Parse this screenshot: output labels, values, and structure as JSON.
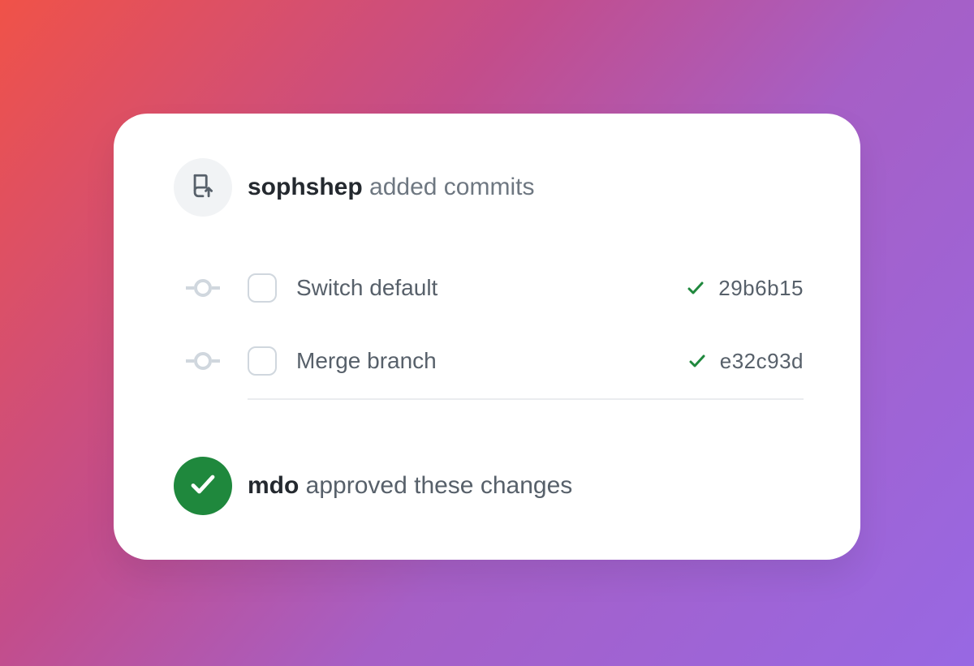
{
  "header": {
    "user": "sophshep",
    "action": "added commits"
  },
  "commits": [
    {
      "message": "Switch default",
      "status": "success",
      "sha": "29b6b15"
    },
    {
      "message": "Merge branch",
      "status": "success",
      "sha": "e32c93d"
    }
  ],
  "approval": {
    "user": "mdo",
    "action": "approved these changes"
  },
  "colors": {
    "success": "#1f883d",
    "muted": "#57606a",
    "border": "#d0d7de"
  }
}
